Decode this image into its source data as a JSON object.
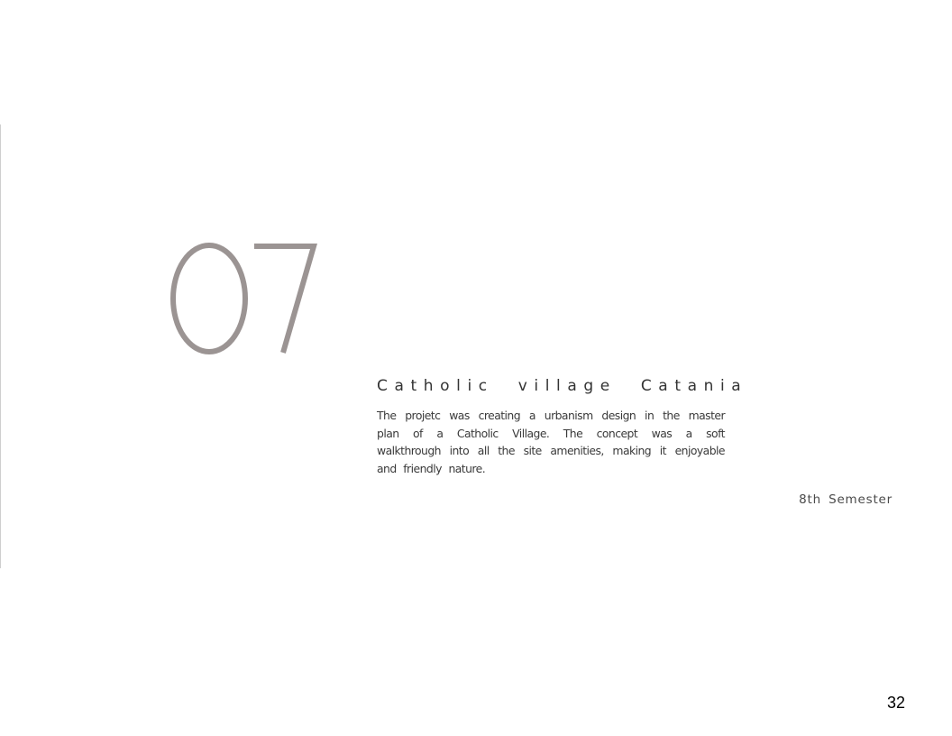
{
  "chapter": {
    "number": "07",
    "number_color": "#9b9493"
  },
  "project": {
    "title": "Catholic village Catania",
    "description": "The projetc was creating a urbanism design in the master plan of a Catholic Village. The concept was a soft walkthrough into all the site amenities, making it enjoyable and friendly nature.",
    "semester": "8th Semester"
  },
  "footer": {
    "page_number": "32"
  }
}
